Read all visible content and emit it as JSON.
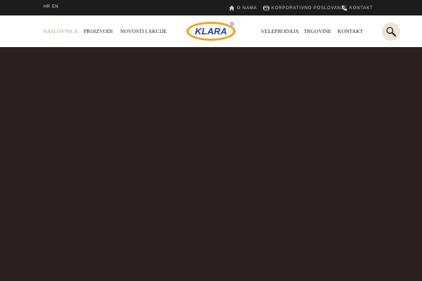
{
  "topbar": {
    "languages": [
      "HR",
      "EN"
    ],
    "links": [
      {
        "label": "O NAMA",
        "icon": "home-icon"
      },
      {
        "label": "KORPORATIVNO POSLOVANJE",
        "icon": "handshake-icon"
      },
      {
        "label": "KONTAKT",
        "icon": "phone-icon"
      }
    ]
  },
  "header": {
    "logo_text": "KLARA",
    "nav_left": [
      "NASLOVNICA",
      "PROIZVODI",
      "NOVOSTI I AKCIJE"
    ],
    "nav_right": [
      "VELEPRODAJA",
      "TRGOVINE",
      "KONTAKT"
    ],
    "active_item": "NASLOVNICA",
    "search_icon": "search-icon"
  },
  "colors": {
    "topbar_bg": "#1c1c1c",
    "active_nav": "#b99c83",
    "hero_bg": "#2a2123",
    "logo_blue": "#1f3f9a",
    "logo_orange": "#f2a51c",
    "search_bg": "#ede4d3"
  }
}
